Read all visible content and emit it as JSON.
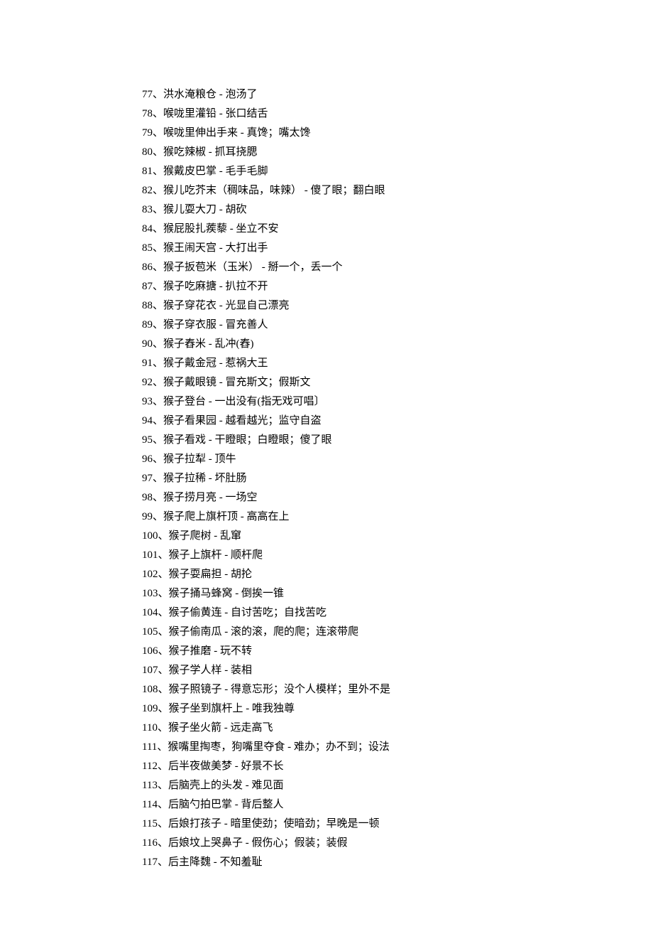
{
  "items": [
    {
      "num": "77",
      "first": "洪水淹粮仓",
      "second": "泡汤了"
    },
    {
      "num": "78",
      "first": "喉咙里灌铅",
      "second": "张口结舌"
    },
    {
      "num": "79",
      "first": "喉咙里伸出手来",
      "second": "真馋；嘴太馋"
    },
    {
      "num": "80",
      "first": "猴吃辣椒",
      "second": "抓耳挠腮"
    },
    {
      "num": "81",
      "first": "猴戴皮巴掌",
      "second": "毛手毛脚"
    },
    {
      "num": "82",
      "first": "猴儿吃芥末（稠味品，味辣）",
      "second": "傻了眼；翻白眼"
    },
    {
      "num": "83",
      "first": "猴儿耍大刀",
      "second": "胡砍"
    },
    {
      "num": "84",
      "first": "猴屁股扎蒺藜",
      "second": "坐立不安"
    },
    {
      "num": "85",
      "first": "猴王闹天宫",
      "second": "大打出手"
    },
    {
      "num": "86",
      "first": "猴子扳苞米（玉米）",
      "second": "掰一个，丢一个"
    },
    {
      "num": "87",
      "first": "猴子吃麻搪",
      "second": "扒拉不开"
    },
    {
      "num": "88",
      "first": "猴子穿花衣",
      "second": "光显自己漂亮"
    },
    {
      "num": "89",
      "first": "猴子穿衣服",
      "second": "冒充善人"
    },
    {
      "num": "90",
      "first": "猴子舂米",
      "second": "乱冲(舂)"
    },
    {
      "num": "91",
      "first": "猴子戴金冠",
      "second": "惹祸大王"
    },
    {
      "num": "92",
      "first": "猴子戴眼镜",
      "second": "冒充斯文；假斯文"
    },
    {
      "num": "93",
      "first": "猴子登台",
      "second": "一出没有(指无戏可唱〕"
    },
    {
      "num": "94",
      "first": "猴子看果园",
      "second": "越看越光；监守自盗"
    },
    {
      "num": "95",
      "first": "猴子看戏",
      "second": "干瞪眼；白瞪眼；傻了眼"
    },
    {
      "num": "96",
      "first": "猴子拉犁",
      "second": "顶牛"
    },
    {
      "num": "97",
      "first": "猴子拉稀",
      "second": "坏肚肠"
    },
    {
      "num": "98",
      "first": "猴子捞月亮",
      "second": "一场空"
    },
    {
      "num": "99",
      "first": "猴子爬上旗杆顶",
      "second": "高高在上"
    },
    {
      "num": "100",
      "first": "猴子爬树",
      "second": "乱窜"
    },
    {
      "num": "101",
      "first": "猴子上旗杆",
      "second": "顺杆爬"
    },
    {
      "num": "102",
      "first": "猴子耍扁担",
      "second": "胡抡"
    },
    {
      "num": "103",
      "first": "猴子捅马蜂窝",
      "second": "倒挨一锥"
    },
    {
      "num": "104",
      "first": "猴子偷黄连",
      "second": "自讨苦吃；自找苦吃"
    },
    {
      "num": "105",
      "first": "猴子偷南瓜",
      "second": "滚的滚，爬的爬；连滚带爬"
    },
    {
      "num": "106",
      "first": "猴子推磨",
      "second": "玩不转"
    },
    {
      "num": "107",
      "first": "猴子学人样",
      "second": "装相"
    },
    {
      "num": "108",
      "first": "猴子照镜子",
      "second": "得意忘形；没个人模样；里外不是"
    },
    {
      "num": "109",
      "first": "猴子坐到旗杆上",
      "second": "唯我独尊"
    },
    {
      "num": "110",
      "first": "猴子坐火箭",
      "second": "远走高飞"
    },
    {
      "num": "111",
      "first": "猴嘴里掏枣，狗嘴里夺食",
      "second": "难办；办不到；设法"
    },
    {
      "num": "112",
      "first": "后半夜做美梦",
      "second": "好景不长"
    },
    {
      "num": "113",
      "first": "后脑壳上的头发",
      "second": "难见面"
    },
    {
      "num": "114",
      "first": "后脑勺拍巴掌",
      "second": "背后整人"
    },
    {
      "num": "115",
      "first": "后娘打孩子",
      "second": "暗里使劲；使暗劲；早晚是一顿"
    },
    {
      "num": "116",
      "first": "后娘坟上哭鼻子",
      "second": "假伤心；假装；装假"
    },
    {
      "num": "117",
      "first": "后主降魏",
      "second": "不知羞耻"
    }
  ]
}
